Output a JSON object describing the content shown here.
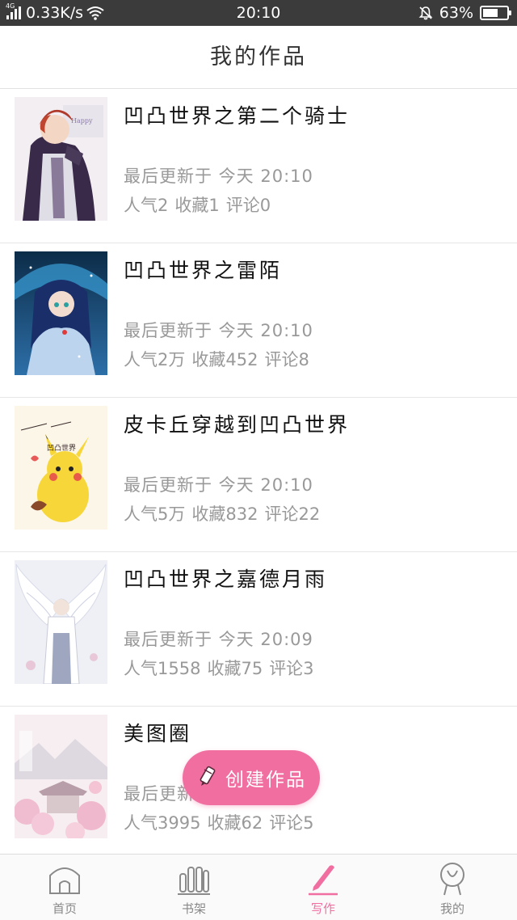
{
  "status_bar": {
    "network_label": "4G",
    "speed": "0.33K/s",
    "time": "20:10",
    "battery": "63%",
    "battery_level": 0.63
  },
  "header": {
    "title": "我的作品"
  },
  "works": [
    {
      "title": "凹凸世界之第二个骑士",
      "updated": "最后更新于 今天 20:10",
      "popularity": "人气2",
      "favorites": "收藏1",
      "comments": "评论0",
      "cover_icon": "cover-knight"
    },
    {
      "title": "凹凸世界之雷陌",
      "updated": "最后更新于 今天 20:10",
      "popularity": "人气2万",
      "favorites": "收藏452",
      "comments": "评论8",
      "cover_icon": "cover-girl-blue"
    },
    {
      "title": "皮卡丘穿越到凹凸世界",
      "updated": "最后更新于 今天 20:10",
      "popularity": "人气5万",
      "favorites": "收藏832",
      "comments": "评论22",
      "cover_icon": "cover-pikachu"
    },
    {
      "title": "凹凸世界之嘉德月雨",
      "updated": "最后更新于 今天 20:09",
      "popularity": "人气1558",
      "favorites": "收藏75",
      "comments": "评论3",
      "cover_icon": "cover-angel"
    },
    {
      "title": "美图圈",
      "updated": "最后更新于 今天",
      "popularity": "人气3995",
      "favorites": "收藏62",
      "comments": "评论5",
      "cover_icon": "cover-sakura"
    }
  ],
  "fab": {
    "label": "创建作品",
    "icon": "pencil-icon",
    "color": "#f06fa0"
  },
  "tabbar": {
    "tabs": [
      {
        "label": "首页",
        "icon": "home-icon",
        "active": false
      },
      {
        "label": "书架",
        "icon": "bookshelf-icon",
        "active": false
      },
      {
        "label": "写作",
        "icon": "write-icon",
        "active": true
      },
      {
        "label": "我的",
        "icon": "profile-icon",
        "active": false
      }
    ],
    "active_color": "#f06fa0",
    "inactive_color": "#888888"
  }
}
